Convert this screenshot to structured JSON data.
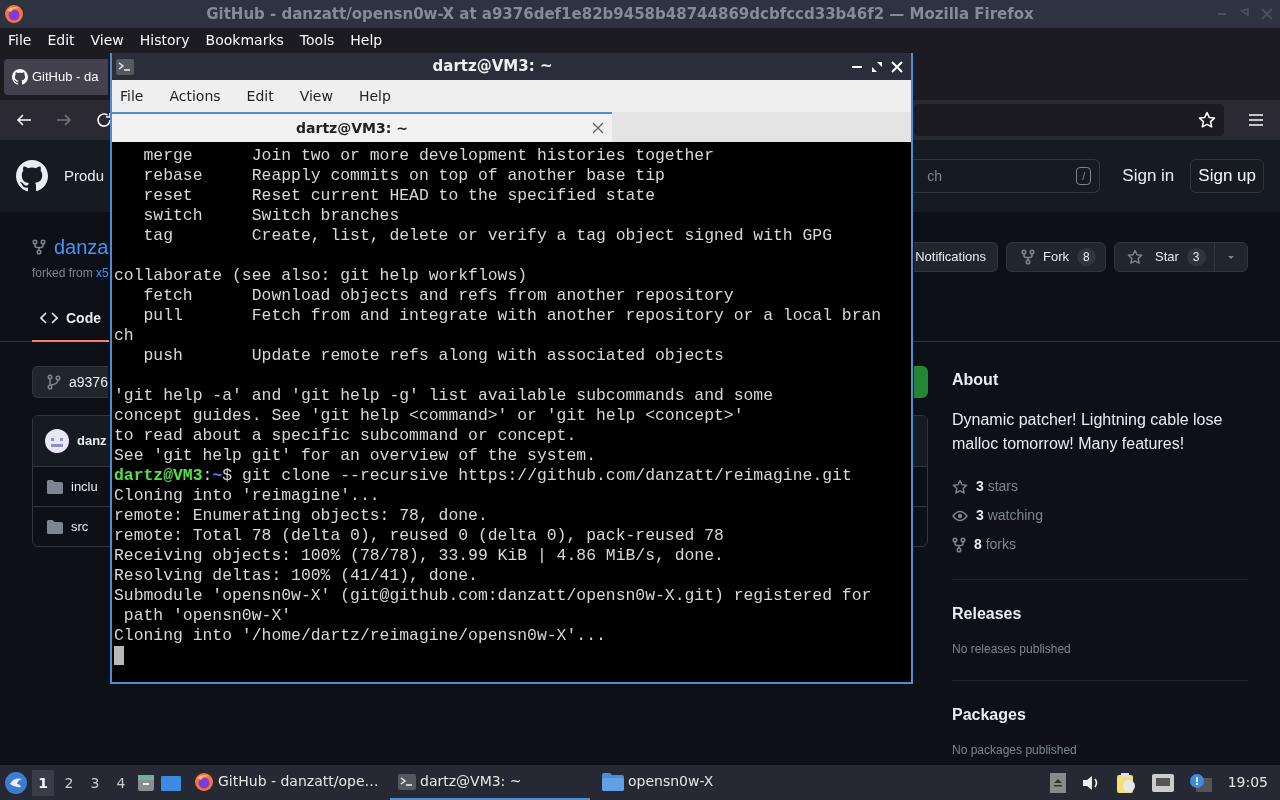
{
  "firefox": {
    "title": "GitHub - danzatt/opensn0w-X at a9376def1e82b9458b48744869dcbfccd33b46f2 — Mozilla Firefox",
    "menu": [
      "File",
      "Edit",
      "View",
      "History",
      "Bookmarks",
      "Tools",
      "Help"
    ],
    "tab": {
      "title": "GitHub - da"
    }
  },
  "github": {
    "header": {
      "nav_item": "Produ",
      "search_placeholder": "ch",
      "search_key": "/",
      "sign_in": "Sign in",
      "sign_up": "Sign up"
    },
    "repo": {
      "name": "danza",
      "forked_label": "forked from",
      "forked_link": "x5"
    },
    "actions": {
      "notifications": "Notifications",
      "fork": {
        "label": "Fork",
        "count": "8"
      },
      "star": {
        "label": "Star",
        "count": "3"
      }
    },
    "tabs": [
      {
        "label": "Code",
        "selected": true
      }
    ],
    "branch": "a9376",
    "commit_author": "danz",
    "files": [
      {
        "name": "inclu",
        "kind": "folder"
      },
      {
        "name": "src",
        "kind": "folder"
      }
    ],
    "about": {
      "heading": "About",
      "description": "Dynamic patcher! Lightning cable lose malloc tomorrow! Many features!",
      "stats": [
        {
          "kind": "star",
          "value": "3",
          "label": "stars"
        },
        {
          "kind": "eye",
          "value": "3",
          "label": "watching"
        },
        {
          "kind": "fork",
          "value": "8",
          "label": "forks"
        }
      ]
    },
    "releases": {
      "heading": "Releases",
      "text": "No releases published"
    },
    "packages": {
      "heading": "Packages",
      "text": "No packages published"
    }
  },
  "terminal": {
    "title": "dartz@VM3: ~",
    "menu": [
      "File",
      "Actions",
      "Edit",
      "View",
      "Help"
    ],
    "tab": {
      "title": "dartz@VM3: ~"
    },
    "lines": [
      {
        "kind": "output",
        "text": "   merge      Join two or more development histories together"
      },
      {
        "kind": "output",
        "text": "   rebase     Reapply commits on top of another base tip"
      },
      {
        "kind": "output",
        "text": "   reset      Reset current HEAD to the specified state"
      },
      {
        "kind": "output",
        "text": "   switch     Switch branches"
      },
      {
        "kind": "output",
        "text": "   tag        Create, list, delete or verify a tag object signed with GPG"
      },
      {
        "kind": "blank"
      },
      {
        "kind": "output",
        "text": "collaborate (see also: git help workflows)"
      },
      {
        "kind": "output",
        "text": "   fetch      Download objects and refs from another repository"
      },
      {
        "kind": "output",
        "text": "   pull       Fetch from and integrate with another repository or a local bran"
      },
      {
        "kind": "output",
        "text": "ch"
      },
      {
        "kind": "output",
        "text": "   push       Update remote refs along with associated objects"
      },
      {
        "kind": "blank"
      },
      {
        "kind": "output",
        "text": "'git help -a' and 'git help -g' list available subcommands and some"
      },
      {
        "kind": "output",
        "text": "concept guides. See 'git help <command>' or 'git help <concept>'"
      },
      {
        "kind": "output",
        "text": "to read about a specific subcommand or concept."
      },
      {
        "kind": "output",
        "text": "See 'git help git' for an overview of the system."
      },
      {
        "kind": "prompt",
        "user": "dartz@VM3",
        "separator": ":",
        "path": "~",
        "command": "$ git clone --recursive https://github.com/danzatt/reimagine.git"
      },
      {
        "kind": "output",
        "text": "Cloning into 'reimagine'..."
      },
      {
        "kind": "output",
        "text": "remote: Enumerating objects: 78, done."
      },
      {
        "kind": "output",
        "text": "remote: Total 78 (delta 0), reused 0 (delta 0), pack-reused 78"
      },
      {
        "kind": "output",
        "text": "Receiving objects: 100% (78/78), 33.99 KiB | 4.86 MiB/s, done."
      },
      {
        "kind": "output",
        "text": "Resolving deltas: 100% (41/41), done."
      },
      {
        "kind": "output",
        "text": "Submodule 'opensn0w-X' (git@github.com:danzatt/opensn0w-X.git) registered for"
      },
      {
        "kind": "output",
        "text": " path 'opensn0w-X'"
      },
      {
        "kind": "output",
        "text": "Cloning into '/home/dartz/reimagine/opensn0w-X'..."
      },
      {
        "kind": "cursor"
      }
    ]
  },
  "taskbar": {
    "workspaces": [
      {
        "label": "1",
        "selected": true
      },
      {
        "label": "2",
        "selected": false
      },
      {
        "label": "3",
        "selected": false
      },
      {
        "label": "4",
        "selected": false
      }
    ],
    "tasks": [
      {
        "kind": "browser",
        "title": "GitHub - danzatt/ope…",
        "selected": false
      },
      {
        "kind": "terminal",
        "title": "dartz@VM3: ~",
        "selected": true
      },
      {
        "kind": "folder",
        "title": "opensn0w-X",
        "selected": false
      }
    ],
    "clock": "19:05"
  }
}
